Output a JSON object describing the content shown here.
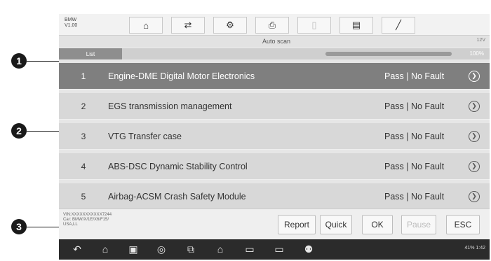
{
  "topbar": {
    "brand_line1": "BMW",
    "brand_line2": "V1.00",
    "toolbar_icons": [
      "home-icon",
      "vehicle-swap-icon",
      "settings-icon",
      "print-icon",
      "help-icon",
      "save-icon",
      "edit-icon"
    ],
    "toolbar_glyphs": [
      "⌂",
      "⇄",
      "⚙",
      "⎙",
      "▯",
      "▤",
      "╱"
    ]
  },
  "subbar": {
    "title": "Auto scan",
    "right_text": "12V"
  },
  "listbar": {
    "tab_label": "List",
    "progress_percent_text": "100%",
    "progress_fraction": 1.0
  },
  "systems": [
    {
      "num": "1",
      "name": "Engine-DME Digital Motor Electronics",
      "status": "Pass | No Fault",
      "selected": true
    },
    {
      "num": "2",
      "name": "EGS transmission management",
      "status": "Pass | No Fault",
      "selected": false
    },
    {
      "num": "3",
      "name": "VTG Transfer case",
      "status": "Pass | No Fault",
      "selected": false
    },
    {
      "num": "4",
      "name": "ABS-DSC Dynamic Stability Control",
      "status": "Pass | No Fault",
      "selected": false
    },
    {
      "num": "5",
      "name": "Airbag-ACSM Crash Safety Module",
      "status": "Pass | No Fault",
      "selected": false
    }
  ],
  "footer": {
    "vin_text": "VIN:XXXXXXXXXXX7244\nCar: BMW/X/1E/X6/F15/\nUSA,LL",
    "buttons": {
      "report": "Report",
      "quick": "Quick",
      "ok": "OK",
      "pause": "Pause",
      "esc": "ESC"
    }
  },
  "navbar": {
    "icons": [
      "back-icon",
      "home-icon",
      "recent-apps-icon",
      "browser-icon",
      "screenshot-icon",
      "vehicle-home-icon",
      "car-icon",
      "car-icon",
      "user-car-icon"
    ],
    "glyphs": [
      "↶",
      "⌂",
      "▣",
      "◎",
      "⧉",
      "⌂",
      "▭",
      "▭",
      "⚉"
    ],
    "status_text": "41% 1:42"
  },
  "callouts": {
    "c1": "1",
    "c2": "2",
    "c3": "3"
  },
  "colors": {
    "selected_row": "#7f7f7f",
    "row": "#d8d8d8",
    "navbar": "#2b2b2b"
  }
}
